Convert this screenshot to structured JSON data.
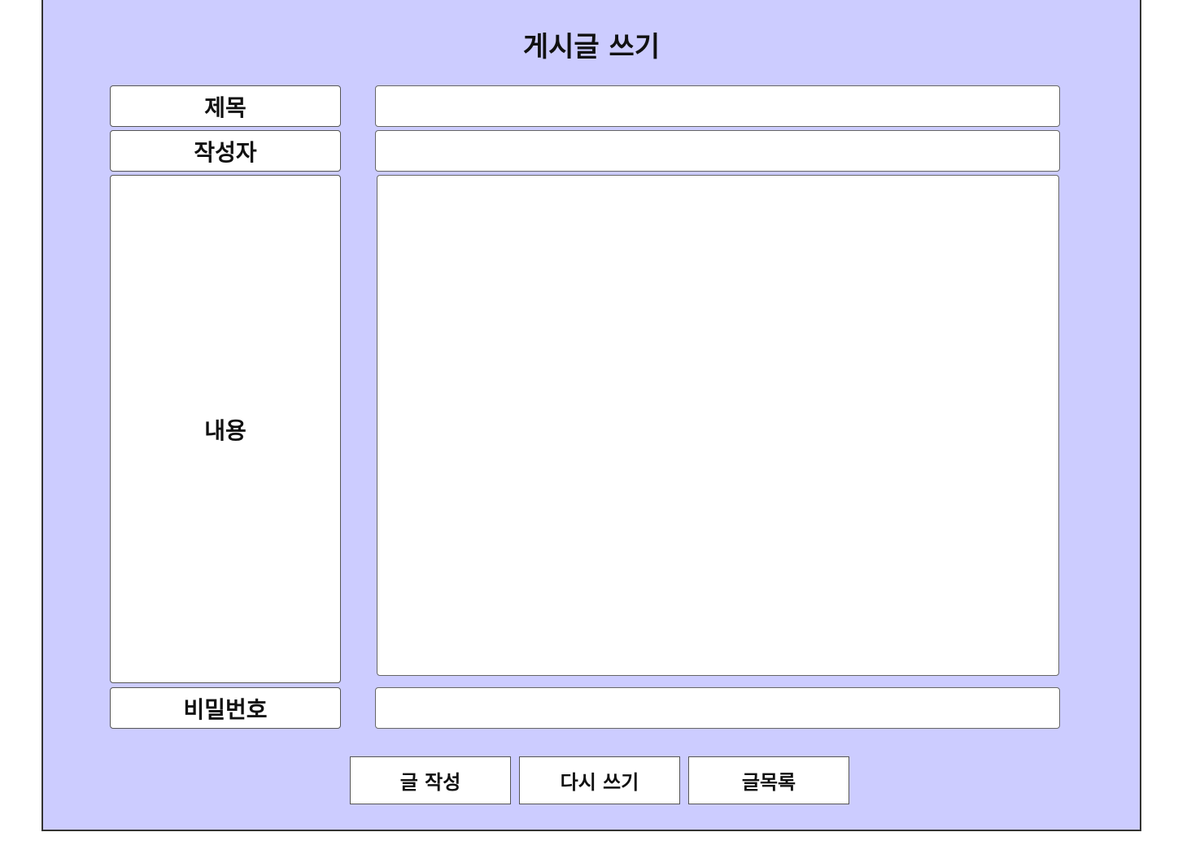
{
  "page": {
    "title": "게시글 쓰기"
  },
  "form": {
    "title_label": "제목",
    "title_value": "",
    "author_label": "작성자",
    "author_value": "",
    "content_label": "내용",
    "content_value": "",
    "password_label": "비밀번호",
    "password_value": ""
  },
  "buttons": {
    "submit": "글 작성",
    "reset": "다시 쓰기",
    "list": "글목록"
  },
  "colors": {
    "panel_background": "#ccccff"
  }
}
